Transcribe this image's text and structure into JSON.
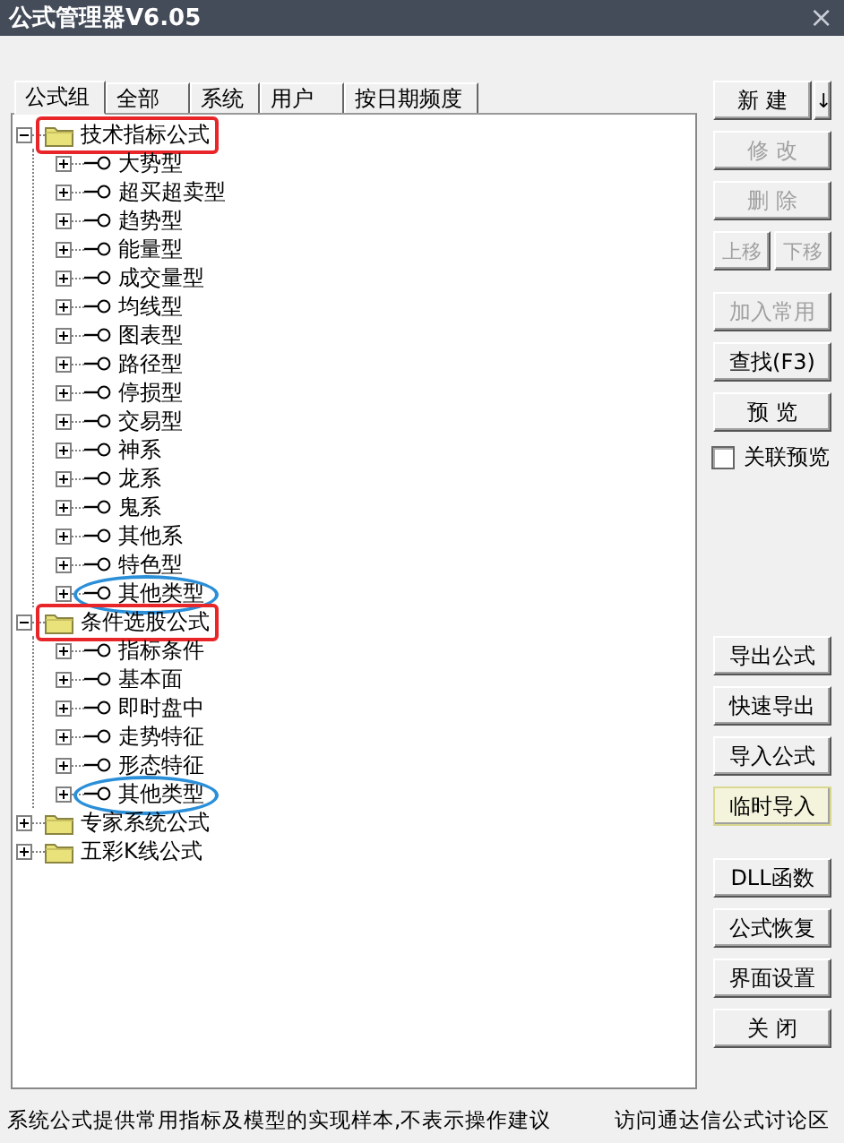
{
  "window": {
    "title": "公式管理器V6.05",
    "close": "×"
  },
  "tabs": [
    {
      "label": "公式组",
      "selected": true
    },
    {
      "label": "全部",
      "selected": false
    },
    {
      "label": "系统",
      "selected": false
    },
    {
      "label": "用户",
      "selected": false
    },
    {
      "label": "按日期频度",
      "selected": false
    }
  ],
  "tree": [
    {
      "kind": "folder",
      "label": "技术指标公式",
      "expanded": true,
      "highlight": {
        "kind": "box",
        "color": "#e8262a"
      },
      "children": [
        {
          "kind": "formula",
          "label": "大势型",
          "expanded": false
        },
        {
          "kind": "formula",
          "label": "超买超卖型",
          "expanded": false
        },
        {
          "kind": "formula",
          "label": "趋势型",
          "expanded": false
        },
        {
          "kind": "formula",
          "label": "能量型",
          "expanded": false
        },
        {
          "kind": "formula",
          "label": "成交量型",
          "expanded": false
        },
        {
          "kind": "formula",
          "label": "均线型",
          "expanded": false
        },
        {
          "kind": "formula",
          "label": "图表型",
          "expanded": false
        },
        {
          "kind": "formula",
          "label": "路径型",
          "expanded": false
        },
        {
          "kind": "formula",
          "label": "停损型",
          "expanded": false
        },
        {
          "kind": "formula",
          "label": "交易型",
          "expanded": false
        },
        {
          "kind": "formula",
          "label": "神系",
          "expanded": false
        },
        {
          "kind": "formula",
          "label": "龙系",
          "expanded": false
        },
        {
          "kind": "formula",
          "label": "鬼系",
          "expanded": false
        },
        {
          "kind": "formula",
          "label": "其他系",
          "expanded": false
        },
        {
          "kind": "formula",
          "label": "特色型",
          "expanded": false
        },
        {
          "kind": "formula",
          "label": "其他类型",
          "expanded": false,
          "highlight": {
            "kind": "oval",
            "color": "#2a8fd8"
          }
        }
      ]
    },
    {
      "kind": "folder",
      "label": "条件选股公式",
      "expanded": true,
      "highlight": {
        "kind": "box",
        "color": "#e8262a"
      },
      "children": [
        {
          "kind": "formula",
          "label": "指标条件",
          "expanded": false
        },
        {
          "kind": "formula",
          "label": "基本面",
          "expanded": false
        },
        {
          "kind": "formula",
          "label": "即时盘中",
          "expanded": false
        },
        {
          "kind": "formula",
          "label": "走势特征",
          "expanded": false
        },
        {
          "kind": "formula",
          "label": "形态特征",
          "expanded": false
        },
        {
          "kind": "formula",
          "label": "其他类型",
          "expanded": false,
          "highlight": {
            "kind": "oval",
            "color": "#2a8fd8"
          }
        }
      ]
    },
    {
      "kind": "folder",
      "label": "专家系统公式",
      "expanded": false
    },
    {
      "kind": "folder",
      "label": "五彩K线公式",
      "expanded": false
    }
  ],
  "button_groups": [
    [
      {
        "kind": "split",
        "label": "新 建",
        "arrow": "↓",
        "disabled": false
      },
      {
        "kind": "button",
        "label": "修 改",
        "disabled": true
      },
      {
        "kind": "button",
        "label": "删 除",
        "disabled": true
      },
      {
        "kind": "pair",
        "items": [
          {
            "label": "上移",
            "disabled": true
          },
          {
            "label": "下移",
            "disabled": true
          }
        ]
      },
      {
        "kind": "button",
        "label": "加入常用",
        "disabled": true
      },
      {
        "kind": "button",
        "label": "查找(F3)",
        "disabled": false
      },
      {
        "kind": "button",
        "label": "预 览",
        "disabled": false
      },
      {
        "kind": "checkbox",
        "label": "关联预览",
        "checked": false
      }
    ],
    [
      {
        "kind": "button",
        "label": "导出公式",
        "disabled": false
      },
      {
        "kind": "button",
        "label": "快速导出",
        "disabled": false
      },
      {
        "kind": "button",
        "label": "导入公式",
        "disabled": false
      },
      {
        "kind": "button",
        "label": "临时导入",
        "disabled": false,
        "focused": true
      }
    ],
    [
      {
        "kind": "button",
        "label": "DLL函数",
        "disabled": false
      },
      {
        "kind": "button",
        "label": "公式恢复",
        "disabled": false
      },
      {
        "kind": "button",
        "label": "界面设置",
        "disabled": false
      },
      {
        "kind": "button",
        "label": "关 闭",
        "disabled": false
      }
    ]
  ],
  "status_bar": {
    "message": "系统公式提供常用指标及模型的实现样本,不表示操作建议",
    "link": "访问通达信公式讨论区"
  }
}
